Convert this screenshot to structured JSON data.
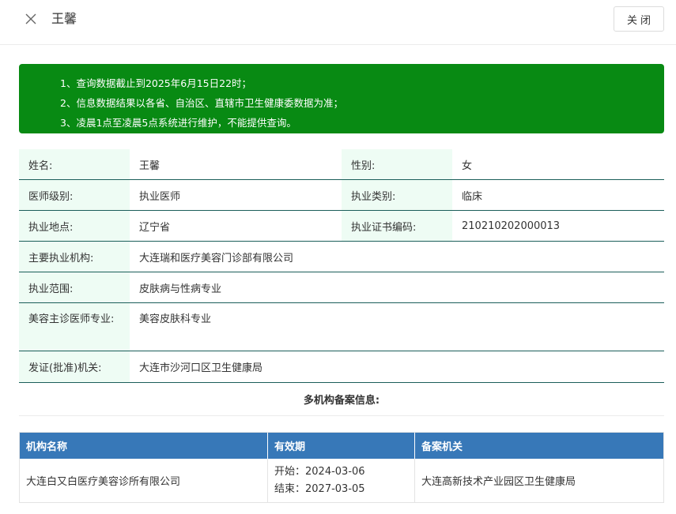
{
  "header": {
    "title": "王馨",
    "close_label": "关闭"
  },
  "notice": {
    "lines": [
      "1、查询数据截止到2025年6月15日22时；",
      "2、信息数据结果以各省、自治区、直辖市卫生健康委数据为准；",
      "3、凌晨1点至凌晨5点系统进行维护，不能提供查询。"
    ]
  },
  "info": {
    "name_label": "姓名:",
    "name_value": "王馨",
    "gender_label": "性别:",
    "gender_value": "女",
    "level_label": "医师级别:",
    "level_value": "执业医师",
    "category_label": "执业类别:",
    "category_value": "临床",
    "location_label": "执业地点:",
    "location_value": "辽宁省",
    "cert_label": "执业证书编码:",
    "cert_value": "210210202000013",
    "org_label": "主要执业机构:",
    "org_value": "大连瑞和医疗美容门诊部有限公司",
    "scope_label": "执业范围:",
    "scope_value": "皮肤病与性病专业",
    "cosmetic_label": "美容主诊医师专业:",
    "cosmetic_value": "美容皮肤科专业",
    "issuer_label": "发证(批准)机关:",
    "issuer_value": "大连市沙河口区卫生健康局"
  },
  "multi": {
    "title": "多机构备案信息:",
    "columns": [
      "机构名称",
      "有效期",
      "备案机关"
    ],
    "rows": [
      {
        "org": "大连白又白医疗美容诊所有限公司",
        "start": "开始：2024-03-06",
        "end": "结束：2027-03-05",
        "authority": "大连高新技术产业园区卫生健康局"
      }
    ]
  },
  "colors": {
    "notice_bg": "#088a13",
    "label_bg": "#eefcf4",
    "row_border": "#1b5e5a",
    "table_header_bg": "#3778b8"
  }
}
